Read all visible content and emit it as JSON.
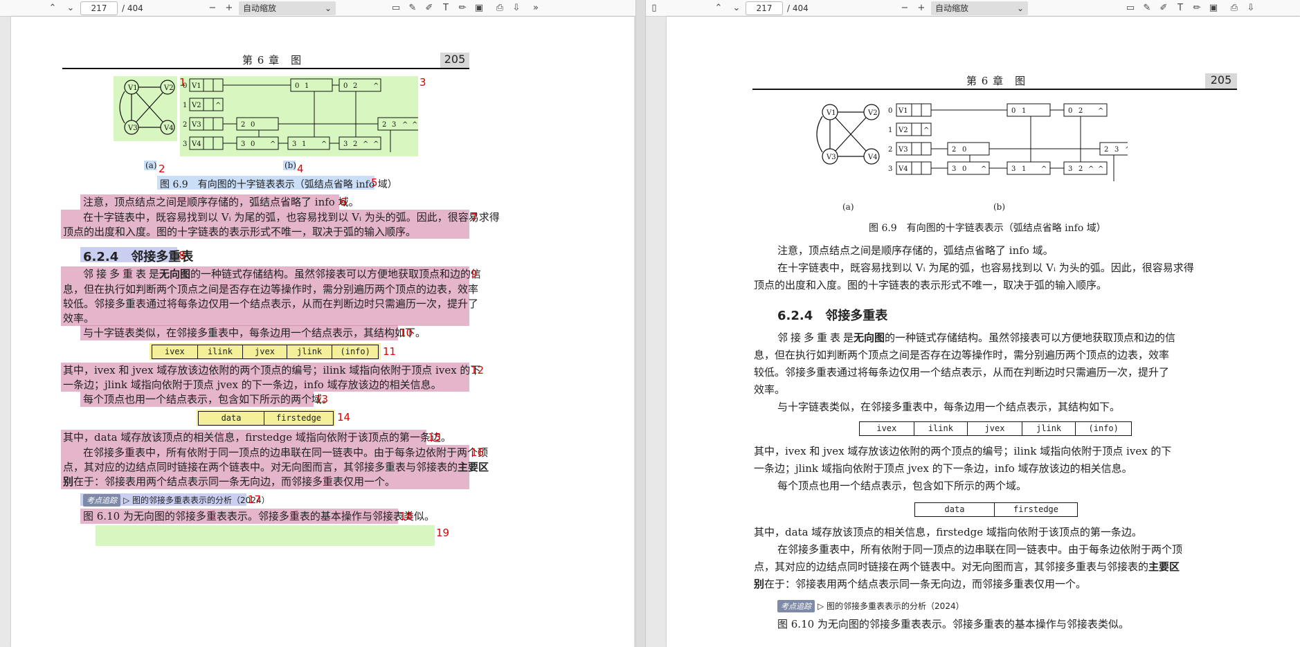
{
  "toolbar": {
    "page_current": "217",
    "page_total": "/ 404",
    "zoom_label": "自动缩放"
  },
  "page": {
    "chapter": "第 6 章　图",
    "page_number": "205",
    "fig_a_label": "(a)",
    "fig_b_label": "(b)",
    "figure_caption_1": "图 6.9　有向图的十字链表表示（弧结点省略 info 域）",
    "para_note": "注意，顶点结点之间是顺序存储的，弧结点省略了 info 域。",
    "para_cross_1": "在十字链表中，既容易找到以 Vᵢ 为尾的弧，也容易找到以 Vᵢ 为头的弧。因此，很容易求得",
    "para_cross_2": "顶点的出度和入度。图的十字链表的表示形式不唯一，取决于弧的输入顺序。",
    "section_title": "6.2.4　邻接多重表",
    "para_multi_1a": "邻接多重表",
    "para_multi_1b": "是",
    "para_multi_1c": "无向图",
    "para_multi_1d": "的一种链式存储结构。虽然邻接表可以方便地获取顶点和边的信",
    "para_multi_2": "息，但在执行如判断两个顶点之间是否存在边等操作时，需分别遍历两个顶点的边表，效率",
    "para_multi_3": "较低。邻接多重表通过将每条边仅用一个结点表示，从而在判断边时只需遍历一次，提升了",
    "para_multi_4": "效率。",
    "para_similar": "与十字链表类似，在邻接多重表中，每条边用一个结点表示，其结构如下。",
    "edge_fields": [
      "ivex",
      "ilink",
      "jvex",
      "jlink",
      "(info)"
    ],
    "para_fields_1": "其中，ivex 和 jvex 域存放该边依附的两个顶点的编号；ilink 域指向依附于顶点 ivex 的下",
    "para_fields_2": "一条边；jlink 域指向依附于顶点 jvex 的下一条边，info 域存放该边的相关信息。",
    "para_vertex": "每个顶点也用一个结点表示，包含如下所示的两个域。",
    "vertex_fields": [
      "data",
      "firstedge"
    ],
    "para_data": "其中，data 域存放该顶点的相关信息，firstedge 域指向依附于该顶点的第一条边。",
    "para_adj_1": "在邻接多重表中，所有依附于同一顶点的边串联在同一链表中。由于每条边依附于两个顶",
    "para_adj_2": "点，其对应的边结点同时链接在两个链表中。对无向图而言，其邻接多重表与邻接表的",
    "para_adj_2b": "主要区",
    "para_adj_3a": "别",
    "para_adj_3b": "在于：邻接表用两个结点表示同一条无向边，而邻接多重表仅用一个。",
    "tag_badge": "考点追踪",
    "tag_text": "图的邻接多重表表示的分析（2024）",
    "para_fig610": "图 6.10 为无向图的邻接多重表表示。邻接多重表的基本操作与邻接表类似。",
    "graph_nodes": [
      "V1",
      "V2",
      "V3",
      "V4"
    ],
    "row_indices": [
      "0",
      "1",
      "2",
      "3"
    ],
    "arc_nodes": [
      [
        "0",
        "1"
      ],
      [
        "0",
        "2"
      ],
      [
        "2",
        "0"
      ],
      [
        "2",
        "3"
      ],
      [
        "3",
        "0"
      ],
      [
        "3",
        "1"
      ],
      [
        "3",
        "2"
      ]
    ],
    "null_symbol": "^"
  },
  "annotations": [
    "1",
    "2",
    "3",
    "4",
    "5",
    "6",
    "7",
    "8",
    "9",
    "10",
    "11",
    "12",
    "13",
    "14",
    "15",
    "16",
    "17",
    "18",
    "19"
  ],
  "colors": {
    "pink": "#ce78a0",
    "green": "#bef096",
    "blue": "#96bef0",
    "yellow": "#f0eb78",
    "annotation": "#e00000"
  }
}
